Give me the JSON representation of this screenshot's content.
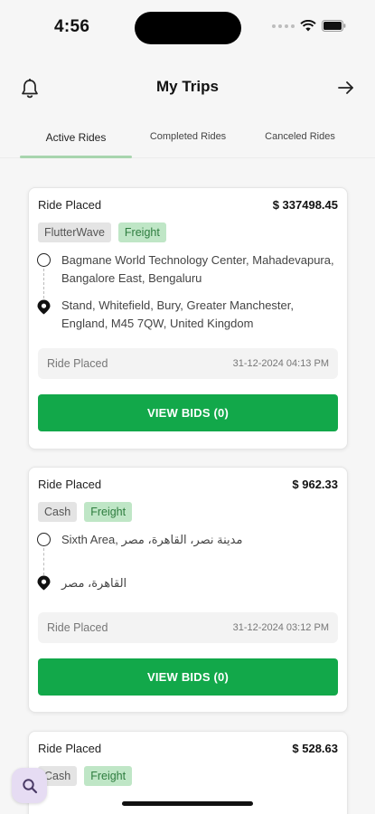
{
  "status_bar": {
    "time": "4:56"
  },
  "header": {
    "title": "My Trips"
  },
  "tabs": [
    {
      "label": "Active Rides",
      "active": true
    },
    {
      "label": "Completed Rides",
      "active": false
    },
    {
      "label": "Canceled Rides",
      "active": false
    }
  ],
  "rides": [
    {
      "status": "Ride Placed",
      "price": "$ 337498.45",
      "payment": "FlutterWave",
      "type": "Freight",
      "pickup": "Bagmane World Technology Center, Mahadevapura, Bangalore East, Bengaluru",
      "dropoff": "Stand, Whitefield, Bury, Greater Manchester, England, M45 7QW, United Kingdom",
      "info_status": "Ride Placed",
      "date": "31-12-2024 04:13 PM",
      "button": "VIEW BIDS (0)"
    },
    {
      "status": "Ride Placed",
      "price": "$ 962.33",
      "payment": "Cash",
      "type": "Freight",
      "pickup": "Sixth Area, مدينة نصر، القاهرة، مصر",
      "dropoff": "القاهرة، مصر",
      "info_status": "Ride Placed",
      "date": "31-12-2024 03:12 PM",
      "button": "VIEW BIDS (0)"
    },
    {
      "status": "Ride Placed",
      "price": "$ 528.63",
      "payment": "Cash",
      "type": "Freight"
    }
  ],
  "colors": {
    "accent": "#12a84a",
    "badge_freight_bg": "#bfe6c6",
    "tab_underline": "#a8d5ae"
  },
  "icons": {
    "bell": "bell-icon",
    "exit": "arrow-right-icon",
    "search": "search-icon"
  }
}
